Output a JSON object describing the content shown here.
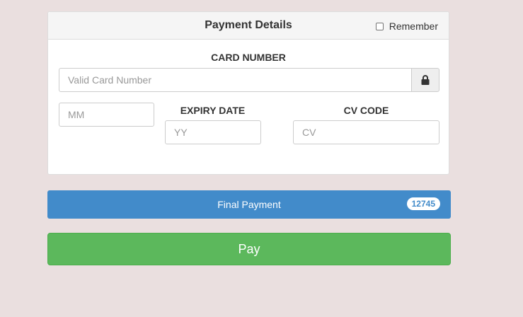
{
  "panel": {
    "title": "Payment Details",
    "remember_label": "Remember",
    "remember_checked": false
  },
  "card_number": {
    "label": "CARD NUMBER",
    "placeholder": "Valid Card Number",
    "addon_icon": "lock-icon"
  },
  "expiry": {
    "label": "EXPIRY DATE",
    "month_placeholder": "MM",
    "year_placeholder": "YY"
  },
  "cv": {
    "label": "CV CODE",
    "placeholder": "CV"
  },
  "final_payment": {
    "label": "Final Payment",
    "amount": "12745",
    "color": "#428bca"
  },
  "pay_button": {
    "label": "Pay",
    "color": "#5cb85c"
  }
}
